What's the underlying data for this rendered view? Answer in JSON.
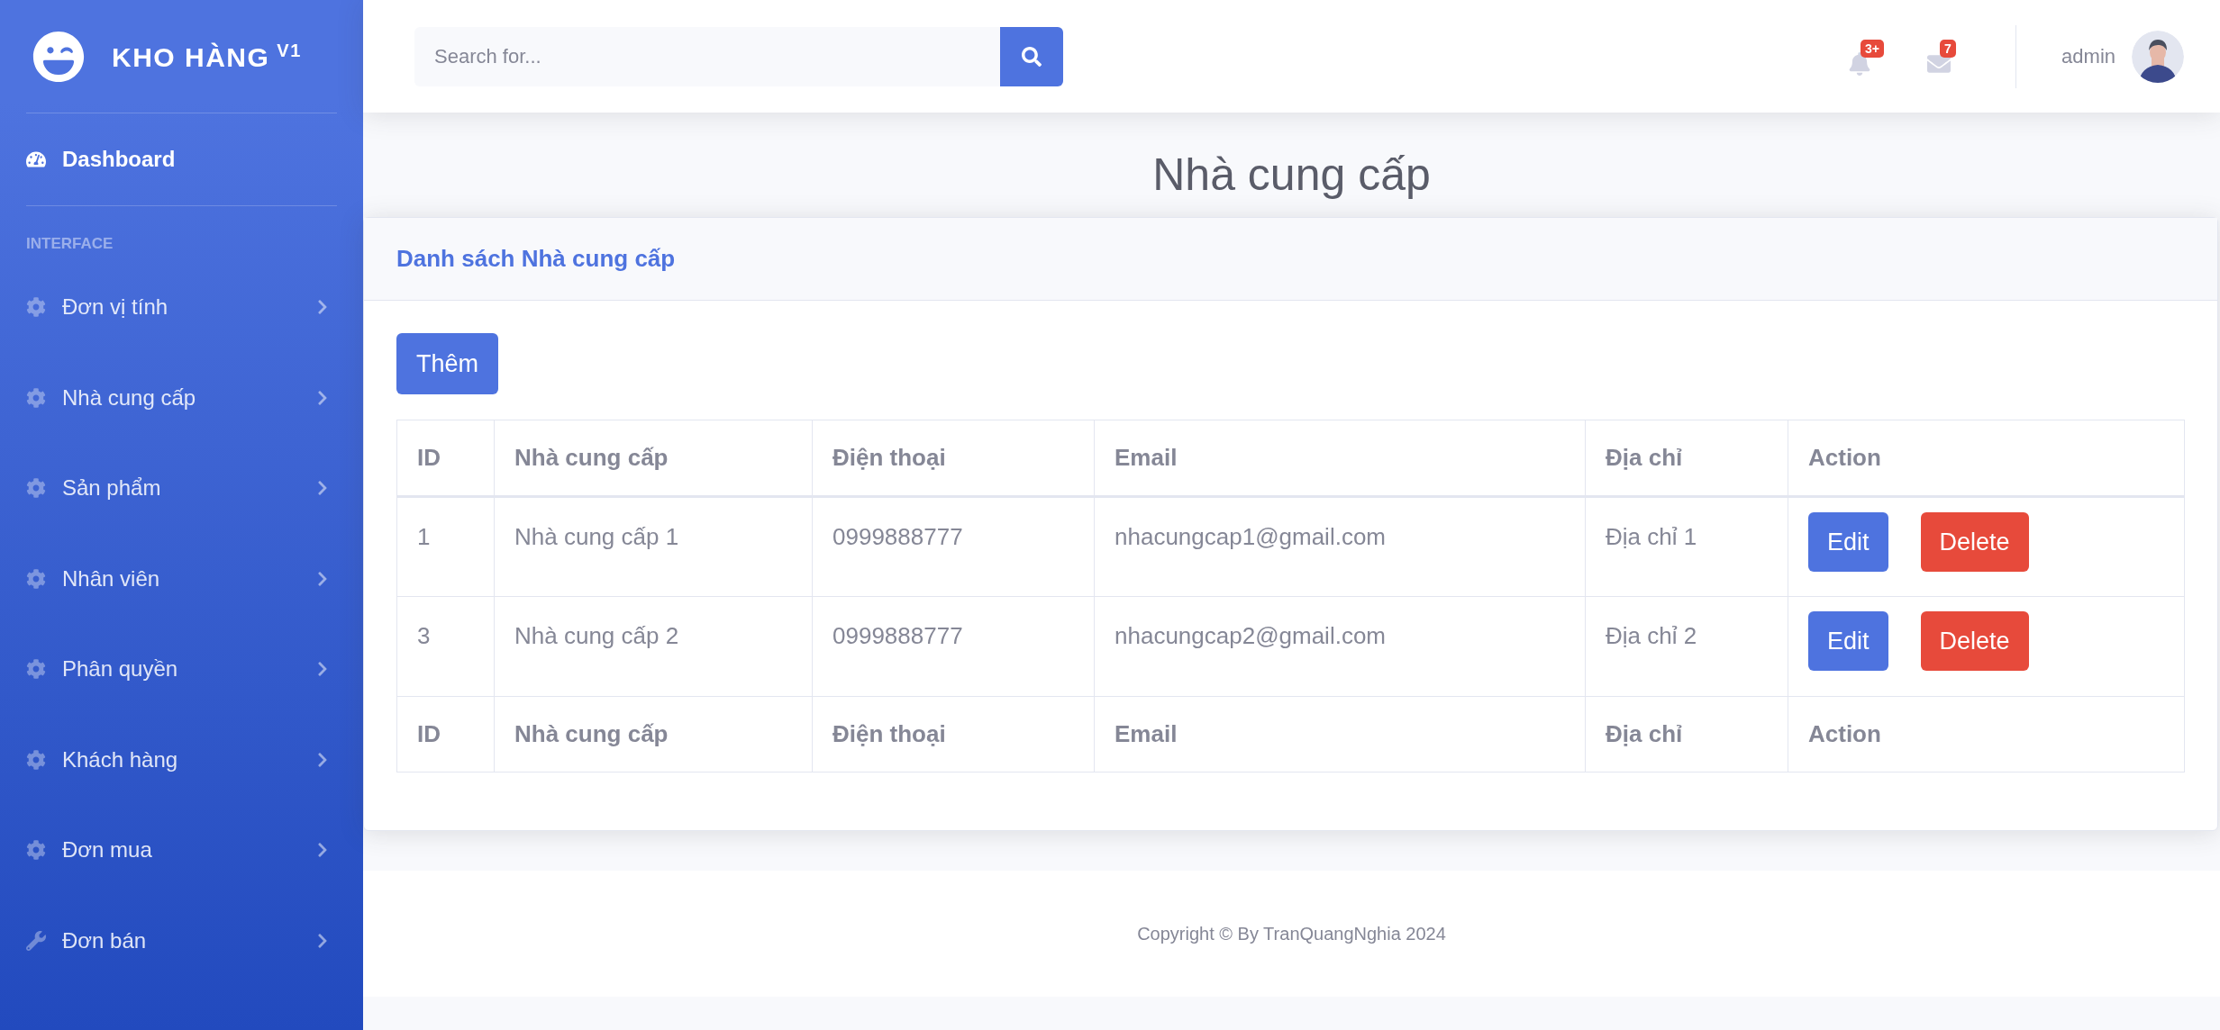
{
  "sidebar": {
    "brand": {
      "name": "KHO HÀNG",
      "superscript": "V1"
    },
    "dashboard": {
      "label": "Dashboard",
      "selected": true
    },
    "heading": "INTERFACE",
    "items": [
      {
        "label": "Đơn vị tính",
        "kind": "settings",
        "expanded": false
      },
      {
        "label": "Nhà cung cấp",
        "kind": "settings",
        "expanded": false
      },
      {
        "label": "Sản phẩm",
        "kind": "settings",
        "expanded": false
      },
      {
        "label": "Nhân viên",
        "kind": "settings",
        "expanded": false
      },
      {
        "label": "Phân quyền",
        "kind": "settings",
        "expanded": false
      },
      {
        "label": "Khách hàng",
        "kind": "settings",
        "expanded": false
      },
      {
        "label": "Đơn mua",
        "kind": "settings",
        "expanded": false
      },
      {
        "label": "Đơn bán",
        "kind": "tools",
        "expanded": false
      }
    ]
  },
  "topbar": {
    "search": {
      "placeholder": "Search for..."
    },
    "alerts": [
      {
        "kind": "bell",
        "badge": "3+"
      },
      {
        "kind": "mail",
        "badge": "7"
      }
    ],
    "user": {
      "name": "admin"
    }
  },
  "page_title": "Nhà cung cấp",
  "card": {
    "title": "Danh sách Nhà cung cấp",
    "add_button": "Thêm",
    "table": {
      "columns": [
        "ID",
        "Nhà cung cấp",
        "Điện thoại",
        "Email",
        "Địa chỉ",
        "Action"
      ],
      "rows": [
        {
          "cells": [
            "1",
            "Nhà cung cấp 1",
            "0999888777",
            "nhacungcap1@gmail.com",
            "Địa chỉ 1"
          ],
          "actions": [
            {
              "label": "Edit",
              "kind": "edit"
            },
            {
              "label": "Delete",
              "kind": "delete"
            }
          ]
        },
        {
          "cells": [
            "3",
            "Nhà cung cấp 2",
            "0999888777",
            "nhacungcap2@gmail.com",
            "Địa chỉ 2"
          ],
          "actions": [
            {
              "label": "Edit",
              "kind": "edit"
            },
            {
              "label": "Delete",
              "kind": "delete"
            }
          ]
        }
      ],
      "footer_columns": [
        "ID",
        "Nhà cung cấp",
        "Điện thoại",
        "Email",
        "Địa chỉ",
        "Action"
      ]
    }
  },
  "footer": {
    "copyright": "Copyright © By TranQuangNghia 2024"
  }
}
